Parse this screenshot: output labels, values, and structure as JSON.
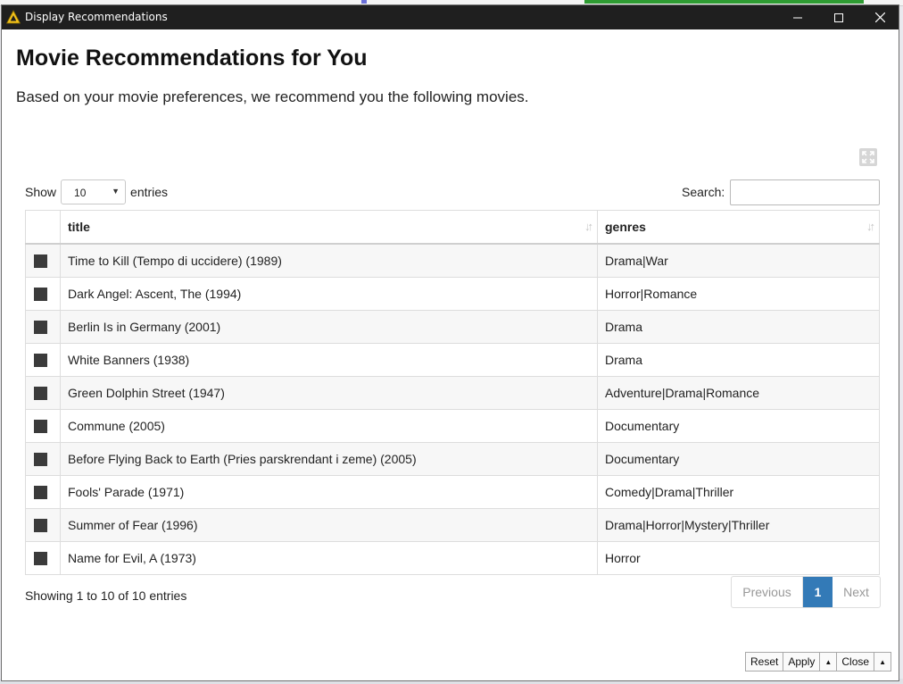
{
  "window": {
    "title": "Display Recommendations",
    "icon": "warning-triangle-icon"
  },
  "page": {
    "heading": "Movie Recommendations for You",
    "subtitle": "Based on your movie preferences, we recommend you the following movies."
  },
  "controls": {
    "show_label": "Show",
    "entries_value": "10",
    "entries_label": "entries",
    "search_label": "Search:",
    "search_value": ""
  },
  "table": {
    "columns": [
      "title",
      "genres"
    ],
    "rows": [
      {
        "title": "Time to Kill (Tempo di uccidere) (1989)",
        "genres": "Drama|War"
      },
      {
        "title": "Dark Angel: Ascent, The (1994)",
        "genres": "Horror|Romance"
      },
      {
        "title": "Berlin Is in Germany (2001)",
        "genres": "Drama"
      },
      {
        "title": "White Banners (1938)",
        "genres": "Drama"
      },
      {
        "title": "Green Dolphin Street (1947)",
        "genres": "Adventure|Drama|Romance"
      },
      {
        "title": "Commune (2005)",
        "genres": "Documentary"
      },
      {
        "title": "Before Flying Back to Earth (Pries parskrendant i zeme) (2005)",
        "genres": "Documentary"
      },
      {
        "title": "Fools' Parade (1971)",
        "genres": "Comedy|Drama|Thriller"
      },
      {
        "title": "Summer of Fear (1996)",
        "genres": "Drama|Horror|Mystery|Thriller"
      },
      {
        "title": "Name for Evil, A (1973)",
        "genres": "Horror"
      }
    ]
  },
  "pagination": {
    "info": "Showing 1 to 10 of 10 entries",
    "previous": "Previous",
    "current": "1",
    "next": "Next"
  },
  "footer": {
    "reset": "Reset",
    "apply": "Apply",
    "close": "Close"
  },
  "colors": {
    "titlebar": "#1f1f1f",
    "pager_active": "#337ab7"
  }
}
